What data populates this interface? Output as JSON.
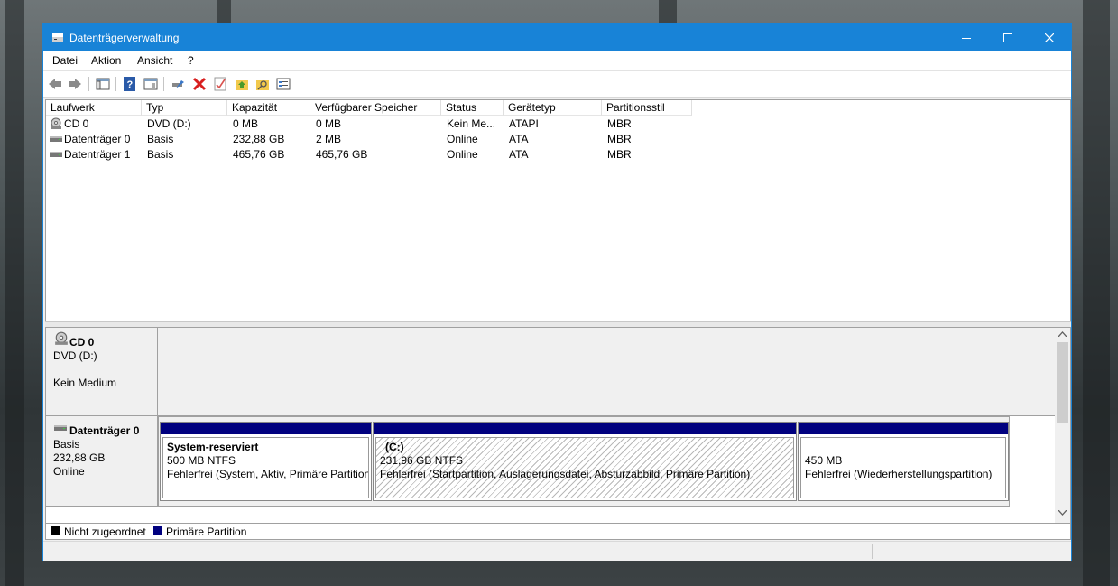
{
  "window": {
    "title": "Datenträgerverwaltung"
  },
  "menu": [
    "Datei",
    "Aktion",
    "Ansicht",
    "?"
  ],
  "list": {
    "columns": [
      "Laufwerk",
      "Typ",
      "Kapazität",
      "Verfügbarer Speicher",
      "Status",
      "Gerätetyp",
      "Partitionsstil"
    ],
    "rows": [
      [
        "CD 0",
        "DVD (D:)",
        "0 MB",
        "0 MB",
        "Kein Me...",
        "ATAPI",
        "MBR"
      ],
      [
        "Datenträger 0",
        "Basis",
        "232,88 GB",
        "2 MB",
        "Online",
        "ATA",
        "MBR"
      ],
      [
        "Datenträger 1",
        "Basis",
        "465,76 GB",
        "465,76 GB",
        "Online",
        "ATA",
        "MBR"
      ]
    ]
  },
  "graphic": {
    "cd": {
      "name": "CD 0",
      "type": "DVD (D:)",
      "status": "Kein Medium"
    },
    "disk0": {
      "name": "Datenträger 0",
      "type": "Basis",
      "size": "232,88 GB",
      "status": "Online",
      "partitions": [
        {
          "name": "System-reserviert",
          "size": "500 MB NTFS",
          "health": "Fehlerfrei (System, Aktiv, Primäre Partition"
        },
        {
          "name": "(C:)",
          "size": "231,96 GB NTFS",
          "health": "Fehlerfrei (Startpartition, Auslagerungsdatei, Absturzabbild, Primäre Partition)"
        },
        {
          "name": "",
          "size": "450 MB",
          "health": "Fehlerfrei (Wiederherstellungspartition)"
        }
      ]
    }
  },
  "legend": {
    "unallocated": "Nicht zugeordnet",
    "primary": "Primäre Partition"
  },
  "colors": {
    "titlebar": "#1883d7",
    "primary_partition": "#00007f",
    "unallocated": "#000000"
  }
}
